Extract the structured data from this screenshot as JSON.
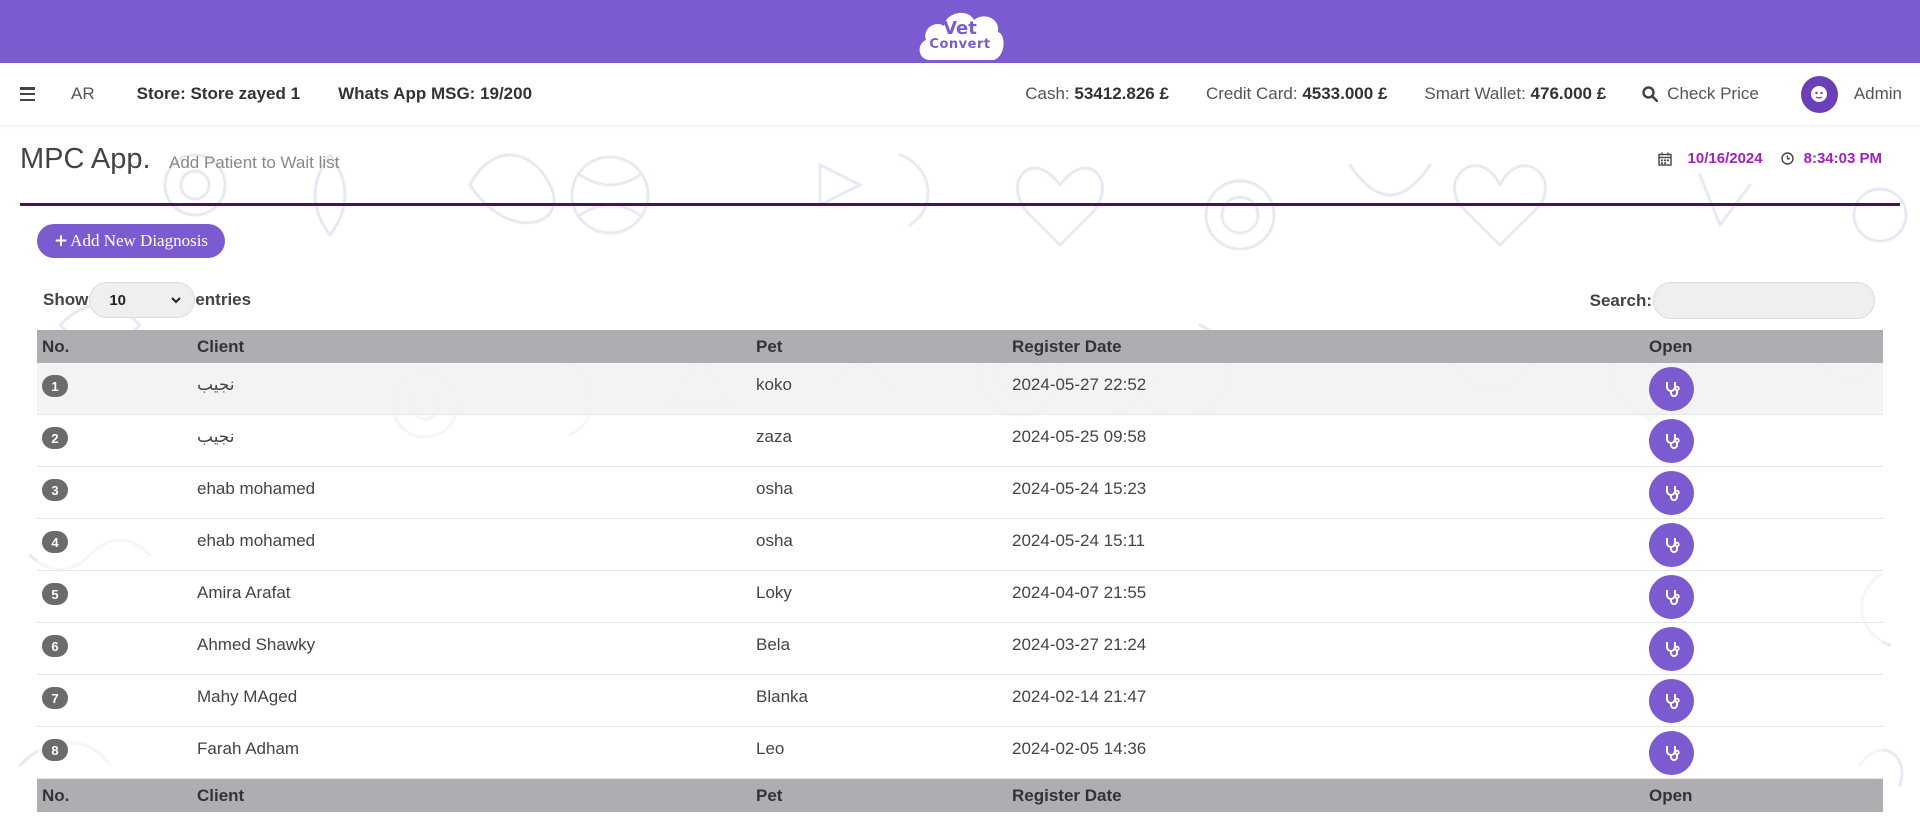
{
  "brand": {
    "logo_line1": "Vet",
    "logo_line2": "Convert"
  },
  "nav": {
    "lang": "AR",
    "store": "Store: Store zayed 1",
    "whats_app": "Whats App MSG: 19/200",
    "cash_label": "Cash:",
    "cash_value": "53412.826 £",
    "card_label": "Credit Card:",
    "card_value": "4533.000 £",
    "wallet_label": "Smart Wallet:",
    "wallet_value": "476.000 £",
    "check_price": "Check Price",
    "user": "Admin"
  },
  "page": {
    "title": "MPC App.",
    "subtitle": "Add Patient to Wait list",
    "date": "10/16/2024",
    "time": "8:34:03 PM",
    "add_button": "Add New Diagnosis",
    "show_label": "Show",
    "show_value": "10",
    "entries_label": "entries",
    "search_label": "Search:"
  },
  "table": {
    "columns": [
      "No.",
      "Client",
      "Pet",
      "Register Date",
      "Open"
    ],
    "rows": [
      {
        "no": "1",
        "client": "نجيب",
        "pet": "koko",
        "date": "2024-05-27 22:52"
      },
      {
        "no": "2",
        "client": "نجيب",
        "pet": "zaza",
        "date": "2024-05-25 09:58"
      },
      {
        "no": "3",
        "client": "ehab mohamed",
        "pet": "osha",
        "date": "2024-05-24 15:23"
      },
      {
        "no": "4",
        "client": "ehab mohamed",
        "pet": "osha",
        "date": "2024-05-24 15:11"
      },
      {
        "no": "5",
        "client": "Amira Arafat",
        "pet": "Loky",
        "date": "2024-04-07 21:55"
      },
      {
        "no": "6",
        "client": "Ahmed Shawky",
        "pet": "Bela",
        "date": "2024-03-27 21:24"
      },
      {
        "no": "7",
        "client": "Mahy MAged",
        "pet": "Blanka",
        "date": "2024-02-14 21:47"
      },
      {
        "no": "8",
        "client": "Farah Adham",
        "pet": "Leo",
        "date": "2024-02-05 14:36"
      }
    ]
  },
  "colors": {
    "primary": "#7b5bcf",
    "accent_text": "#a020c0",
    "header_rule": "#4b0f5c",
    "table_header": "#b0adb2"
  },
  "icons": {
    "menu": "hamburger-icon",
    "search": "search-icon",
    "calendar": "calendar-icon",
    "clock": "clock-icon",
    "open": "stethoscope-icon"
  }
}
